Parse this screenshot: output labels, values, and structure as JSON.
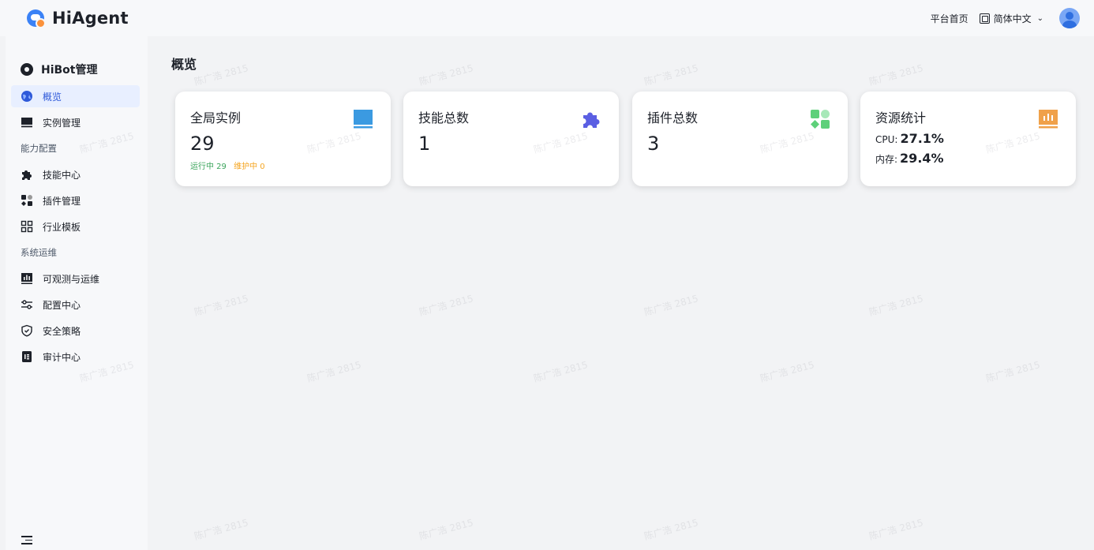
{
  "app": {
    "name": "HiAgent"
  },
  "header": {
    "home_link": "平台首页",
    "language": "简体中文"
  },
  "sidebar": {
    "title": "HiBot管理",
    "items": [
      {
        "label": "概览",
        "icon": "globe-icon",
        "active": true
      },
      {
        "label": "实例管理",
        "icon": "monitor-icon"
      }
    ],
    "group_ability": "能力配置",
    "ability_items": [
      {
        "label": "技能中心",
        "icon": "puzzle-icon"
      },
      {
        "label": "插件管理",
        "icon": "apps-icon"
      },
      {
        "label": "行业模板",
        "icon": "grid-icon"
      }
    ],
    "group_ops": "系统运维",
    "ops_items": [
      {
        "label": "可观测与运维",
        "icon": "chart-icon"
      },
      {
        "label": "配置中心",
        "icon": "sliders-icon"
      },
      {
        "label": "安全策略",
        "icon": "shield-icon"
      },
      {
        "label": "审计中心",
        "icon": "audit-icon"
      }
    ]
  },
  "main": {
    "title": "概览",
    "cards": {
      "instances": {
        "label": "全局实例",
        "value": "29",
        "running": "运行中 29",
        "maintenance": "维护中 0"
      },
      "skills": {
        "label": "技能总数",
        "value": "1"
      },
      "plugins": {
        "label": "插件总数",
        "value": "3"
      },
      "resources": {
        "label": "资源统计",
        "cpu_label": "CPU:",
        "cpu_value": "27.1%",
        "mem_label": "内存:",
        "mem_value": "29.4%"
      }
    }
  },
  "watermark": "陈广浩 2815",
  "colors": {
    "accent": "#2e59d9",
    "instance_icon": "#3b9ae1",
    "skill_icon": "#5b5fe3",
    "plugin_icon": "#5ed07a",
    "resource_icon": "#f0a14a",
    "running": "#3ba55c",
    "maintenance": "#f5a623"
  }
}
